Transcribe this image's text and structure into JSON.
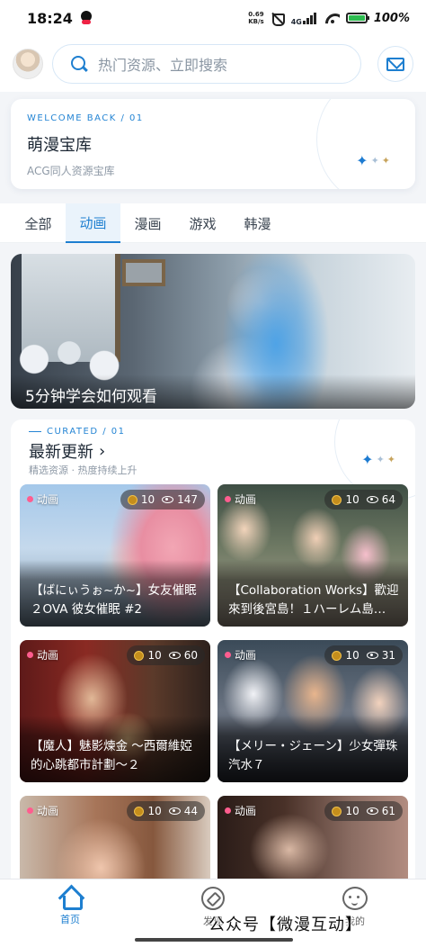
{
  "status_bar": {
    "time": "18:24",
    "net_speed_value": "0.69",
    "net_speed_unit": "KB/s",
    "network": "4G",
    "battery": "100%"
  },
  "header": {
    "search_placeholder": "热门资源、立即搜索"
  },
  "welcome": {
    "eyebrow": "WELCOME BACK / 01",
    "title": "萌漫宝库",
    "subtitle": "ACG同人资源宝库"
  },
  "tabs": [
    {
      "label": "全部",
      "active": false
    },
    {
      "label": "动画",
      "active": true
    },
    {
      "label": "漫画",
      "active": false
    },
    {
      "label": "游戏",
      "active": false
    },
    {
      "label": "韩漫",
      "active": false
    }
  ],
  "banner": {
    "caption": "5分钟学会如何观看"
  },
  "curated": {
    "eyebrow": "CURATED / 01",
    "title": "最新更新",
    "subtitle": "精选资源 · 热度持续上升"
  },
  "cards": [
    {
      "tag": "动画",
      "coins": "10",
      "views": "147",
      "title": "【ばにぃうぉ~か~】女友催眠２OVA 彼女催眠 #2"
    },
    {
      "tag": "动画",
      "coins": "10",
      "views": "64",
      "title": "【Collaboration Works】歡迎來到後宮島！１ハーレム島…"
    },
    {
      "tag": "动画",
      "coins": "10",
      "views": "60",
      "title": "【魔人】魅影煉金 ～西爾維婭的心跳都市計劃～２"
    },
    {
      "tag": "动画",
      "coins": "10",
      "views": "31",
      "title": "【メリー・ジェーン】少女彈珠汽水７"
    },
    {
      "tag": "动画",
      "coins": "10",
      "views": "44",
      "title": ""
    },
    {
      "tag": "动画",
      "coins": "10",
      "views": "61",
      "title": ""
    }
  ],
  "bottom_nav": {
    "home": "首页",
    "discover": "发现",
    "profile": "我的"
  },
  "watermark": "公众号【微漫互动】",
  "colors": {
    "accent": "#1e7fd0",
    "tag_dot": "#ff5d8f"
  }
}
